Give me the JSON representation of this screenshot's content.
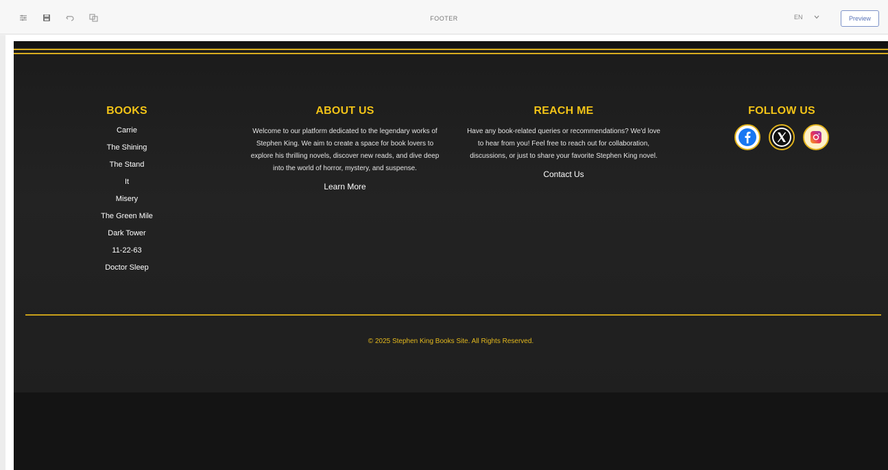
{
  "editor": {
    "title": "FOOTER",
    "language": "EN",
    "preview_label": "Preview",
    "toolbar_icons": [
      "sliders-icon",
      "save-icon",
      "undo-icon",
      "copy-icon"
    ]
  },
  "footer": {
    "books": {
      "heading": "BOOKS",
      "items": [
        "Carrie",
        "The Shining",
        "The Stand",
        "It",
        "Misery",
        "The Green Mile",
        "Dark Tower",
        "11-22-63",
        "Doctor Sleep"
      ]
    },
    "about": {
      "heading": "ABOUT US",
      "text": "Welcome to our platform dedicated to the legendary works of Stephen King. We aim to create a space for book lovers to explore his thrilling novels, discover new reads, and dive deep into the world of horror, mystery, and suspense.",
      "link": "Learn More"
    },
    "reach": {
      "heading": "REACH ME",
      "text": "Have any book-related queries or recommendations? We'd love to hear from you! Feel free to reach out for collaboration, discussions, or just to share your favorite Stephen King novel.",
      "link": "Contact Us"
    },
    "follow": {
      "heading": "FOLLOW US",
      "icons": [
        "facebook-icon",
        "x-icon",
        "instagram-icon"
      ]
    },
    "copyright": "© 2025 Stephen King Books Site. All Rights Reserved.",
    "colors": {
      "gold": "#f2c317",
      "background": "#1f1f1f"
    }
  }
}
